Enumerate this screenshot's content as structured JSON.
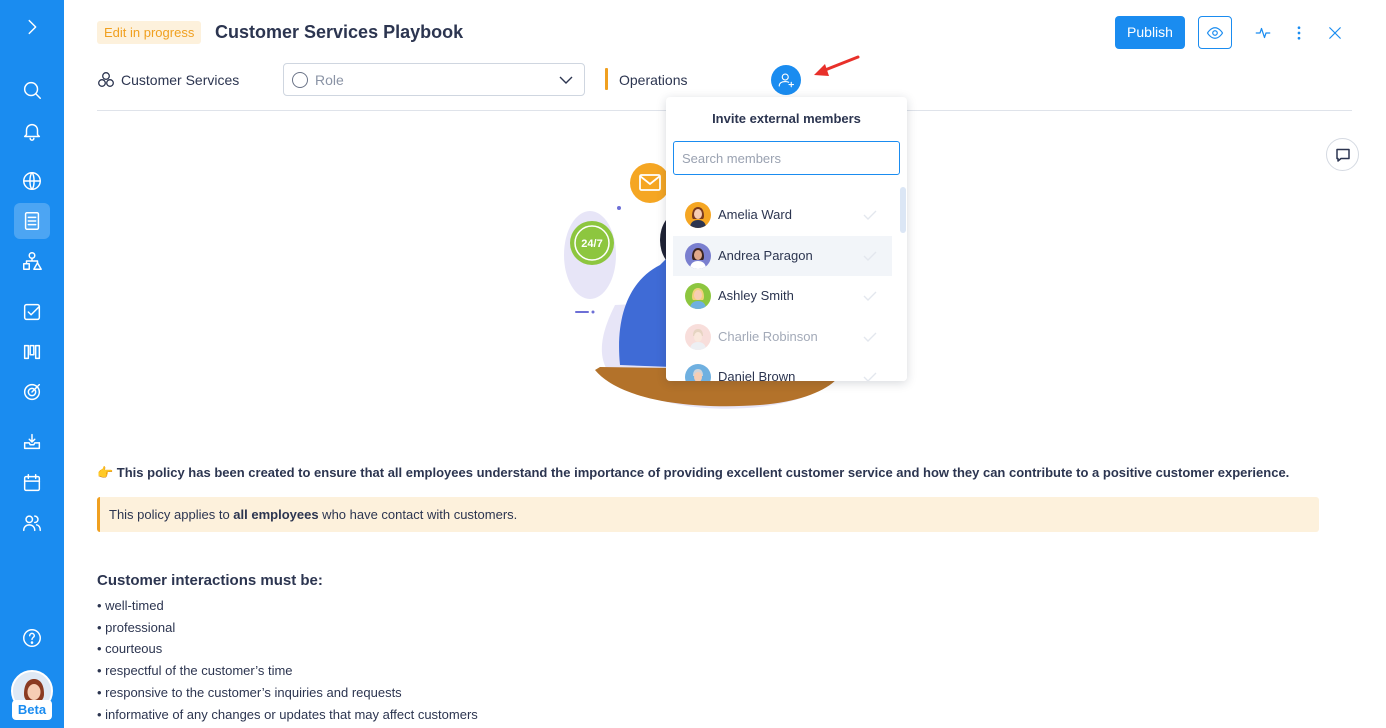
{
  "sidebar": {
    "toggle_icon": "chevron-right-icon",
    "items": [
      {
        "icon": "search-icon"
      },
      {
        "icon": "bell-icon"
      },
      {
        "icon": "globe-icon"
      },
      {
        "icon": "document-icon",
        "active": true
      },
      {
        "icon": "org-chart-icon"
      },
      {
        "icon": "checkbox-icon"
      },
      {
        "icon": "board-icon"
      },
      {
        "icon": "target-icon"
      },
      {
        "icon": "inbox-icon"
      },
      {
        "icon": "calendar-icon"
      },
      {
        "icon": "users-icon"
      },
      {
        "icon": "help-icon"
      }
    ],
    "beta_label": "Beta"
  },
  "header": {
    "status_badge": "Edit in progress",
    "title": "Customer Services Playbook",
    "publish_label": "Publish"
  },
  "meta_bar": {
    "team_label": "Customer Services",
    "role_placeholder": "Role",
    "department_label": "Operations"
  },
  "invite_dropdown": {
    "title": "Invite external members",
    "search_placeholder": "Search members",
    "search_value": "",
    "members": [
      {
        "name": "Amelia Ward",
        "state": "normal"
      },
      {
        "name": "Andrea Paragon",
        "state": "hover"
      },
      {
        "name": "Ashley Smith",
        "state": "normal"
      },
      {
        "name": "Charlie Robinson",
        "state": "dim"
      },
      {
        "name": "Daniel Brown",
        "state": "normal"
      }
    ]
  },
  "content": {
    "policy_intro": "👉 This policy has been created to ensure that all employees understand the importance of providing excellent customer service and how they can contribute to a positive customer experience.",
    "callout_prefix": "This policy applies to ",
    "callout_bold": "all employees",
    "callout_suffix": " who have contact with customers.",
    "interactions_heading": "Customer interactions must be:",
    "interactions": [
      "• well-timed",
      "• professional",
      "• courteous",
      "• respectful of the customer’s time",
      "• responsive to the customer’s inquiries and requests",
      "• informative of any changes or updates that may affect customers"
    ],
    "illustration_badge": "24/7"
  },
  "colors": {
    "primary": "#1a8cf0",
    "accent": "#f0a020",
    "callout_bg": "#fdf1dc",
    "text": "#2c3550",
    "annotation_arrow": "#e8302a"
  }
}
